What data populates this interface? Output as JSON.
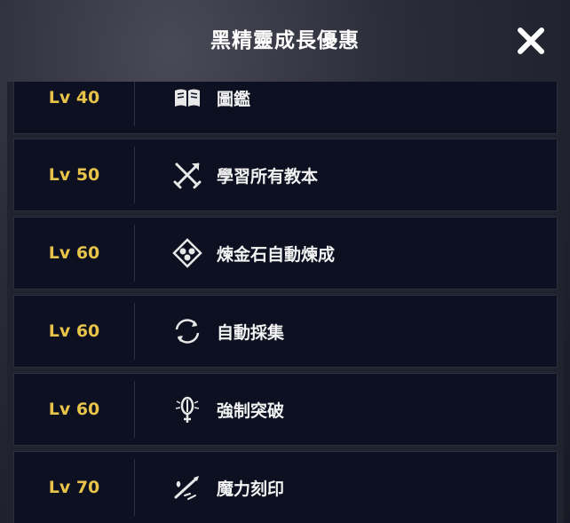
{
  "header": {
    "title": "黑精靈成長優惠"
  },
  "rows": [
    {
      "level": "Lv 40",
      "label": "圖鑑",
      "icon": "book-icon"
    },
    {
      "level": "Lv 50",
      "label": "學習所有教本",
      "icon": "crossed-swords-icon"
    },
    {
      "level": "Lv 60",
      "label": "煉金石自動煉成",
      "icon": "alchemy-diamond-icon"
    },
    {
      "level": "Lv 60",
      "label": "自動採集",
      "icon": "refresh-cycle-icon"
    },
    {
      "level": "Lv 60",
      "label": "強制突破",
      "icon": "breakthrough-icon"
    },
    {
      "level": "Lv 70",
      "label": "魔力刻印",
      "icon": "engrave-tool-icon"
    }
  ]
}
